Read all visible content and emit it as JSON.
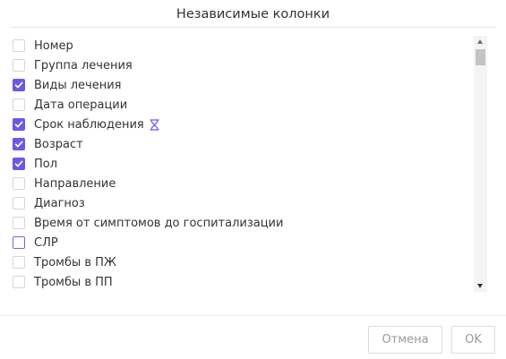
{
  "dialog": {
    "title": "Независимые колонки"
  },
  "columns": [
    {
      "label": "Номер",
      "checked": false
    },
    {
      "label": "Группа лечения",
      "checked": false
    },
    {
      "label": "Виды лечения",
      "checked": true
    },
    {
      "label": "Дата операции",
      "checked": false
    },
    {
      "label": "Срок наблюдения",
      "checked": true,
      "icon": "hourglass-icon"
    },
    {
      "label": "Возраст",
      "checked": true
    },
    {
      "label": "Пол",
      "checked": true
    },
    {
      "label": "Направление",
      "checked": false
    },
    {
      "label": "Диагноз",
      "checked": false
    },
    {
      "label": "Время от симптомов до госпитализации",
      "checked": false
    },
    {
      "label": "СЛР",
      "checked": false,
      "focused": true
    },
    {
      "label": "Тромбы в ПЖ",
      "checked": false
    },
    {
      "label": "Тромбы в ПП",
      "checked": false
    }
  ],
  "footer": {
    "cancel_label": "Отмена",
    "ok_label": "OK"
  },
  "colors": {
    "accent": "#6a58e6",
    "text": "#333333",
    "button_text_disabled": "#9a9a9a"
  }
}
